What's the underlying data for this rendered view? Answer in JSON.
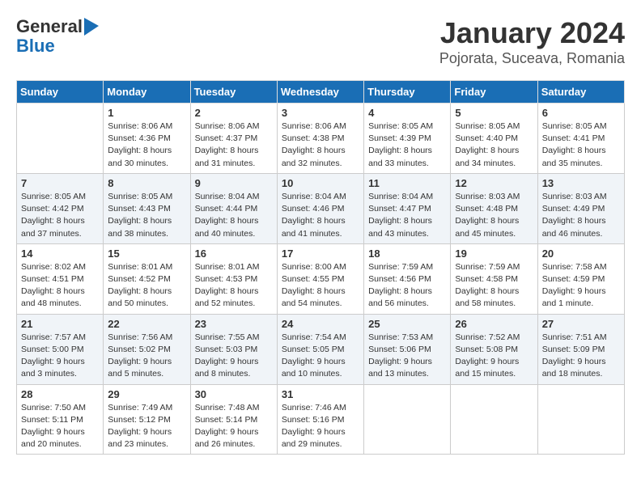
{
  "header": {
    "logo_line1": "General",
    "logo_line2": "Blue",
    "title": "January 2024",
    "subtitle": "Pojorata, Suceava, Romania"
  },
  "weekdays": [
    "Sunday",
    "Monday",
    "Tuesday",
    "Wednesday",
    "Thursday",
    "Friday",
    "Saturday"
  ],
  "weeks": [
    [
      {
        "num": "",
        "info": ""
      },
      {
        "num": "1",
        "info": "Sunrise: 8:06 AM\nSunset: 4:36 PM\nDaylight: 8 hours\nand 30 minutes."
      },
      {
        "num": "2",
        "info": "Sunrise: 8:06 AM\nSunset: 4:37 PM\nDaylight: 8 hours\nand 31 minutes."
      },
      {
        "num": "3",
        "info": "Sunrise: 8:06 AM\nSunset: 4:38 PM\nDaylight: 8 hours\nand 32 minutes."
      },
      {
        "num": "4",
        "info": "Sunrise: 8:05 AM\nSunset: 4:39 PM\nDaylight: 8 hours\nand 33 minutes."
      },
      {
        "num": "5",
        "info": "Sunrise: 8:05 AM\nSunset: 4:40 PM\nDaylight: 8 hours\nand 34 minutes."
      },
      {
        "num": "6",
        "info": "Sunrise: 8:05 AM\nSunset: 4:41 PM\nDaylight: 8 hours\nand 35 minutes."
      }
    ],
    [
      {
        "num": "7",
        "info": "Sunrise: 8:05 AM\nSunset: 4:42 PM\nDaylight: 8 hours\nand 37 minutes."
      },
      {
        "num": "8",
        "info": "Sunrise: 8:05 AM\nSunset: 4:43 PM\nDaylight: 8 hours\nand 38 minutes."
      },
      {
        "num": "9",
        "info": "Sunrise: 8:04 AM\nSunset: 4:44 PM\nDaylight: 8 hours\nand 40 minutes."
      },
      {
        "num": "10",
        "info": "Sunrise: 8:04 AM\nSunset: 4:46 PM\nDaylight: 8 hours\nand 41 minutes."
      },
      {
        "num": "11",
        "info": "Sunrise: 8:04 AM\nSunset: 4:47 PM\nDaylight: 8 hours\nand 43 minutes."
      },
      {
        "num": "12",
        "info": "Sunrise: 8:03 AM\nSunset: 4:48 PM\nDaylight: 8 hours\nand 45 minutes."
      },
      {
        "num": "13",
        "info": "Sunrise: 8:03 AM\nSunset: 4:49 PM\nDaylight: 8 hours\nand 46 minutes."
      }
    ],
    [
      {
        "num": "14",
        "info": "Sunrise: 8:02 AM\nSunset: 4:51 PM\nDaylight: 8 hours\nand 48 minutes."
      },
      {
        "num": "15",
        "info": "Sunrise: 8:01 AM\nSunset: 4:52 PM\nDaylight: 8 hours\nand 50 minutes."
      },
      {
        "num": "16",
        "info": "Sunrise: 8:01 AM\nSunset: 4:53 PM\nDaylight: 8 hours\nand 52 minutes."
      },
      {
        "num": "17",
        "info": "Sunrise: 8:00 AM\nSunset: 4:55 PM\nDaylight: 8 hours\nand 54 minutes."
      },
      {
        "num": "18",
        "info": "Sunrise: 7:59 AM\nSunset: 4:56 PM\nDaylight: 8 hours\nand 56 minutes."
      },
      {
        "num": "19",
        "info": "Sunrise: 7:59 AM\nSunset: 4:58 PM\nDaylight: 8 hours\nand 58 minutes."
      },
      {
        "num": "20",
        "info": "Sunrise: 7:58 AM\nSunset: 4:59 PM\nDaylight: 9 hours\nand 1 minute."
      }
    ],
    [
      {
        "num": "21",
        "info": "Sunrise: 7:57 AM\nSunset: 5:00 PM\nDaylight: 9 hours\nand 3 minutes."
      },
      {
        "num": "22",
        "info": "Sunrise: 7:56 AM\nSunset: 5:02 PM\nDaylight: 9 hours\nand 5 minutes."
      },
      {
        "num": "23",
        "info": "Sunrise: 7:55 AM\nSunset: 5:03 PM\nDaylight: 9 hours\nand 8 minutes."
      },
      {
        "num": "24",
        "info": "Sunrise: 7:54 AM\nSunset: 5:05 PM\nDaylight: 9 hours\nand 10 minutes."
      },
      {
        "num": "25",
        "info": "Sunrise: 7:53 AM\nSunset: 5:06 PM\nDaylight: 9 hours\nand 13 minutes."
      },
      {
        "num": "26",
        "info": "Sunrise: 7:52 AM\nSunset: 5:08 PM\nDaylight: 9 hours\nand 15 minutes."
      },
      {
        "num": "27",
        "info": "Sunrise: 7:51 AM\nSunset: 5:09 PM\nDaylight: 9 hours\nand 18 minutes."
      }
    ],
    [
      {
        "num": "28",
        "info": "Sunrise: 7:50 AM\nSunset: 5:11 PM\nDaylight: 9 hours\nand 20 minutes."
      },
      {
        "num": "29",
        "info": "Sunrise: 7:49 AM\nSunset: 5:12 PM\nDaylight: 9 hours\nand 23 minutes."
      },
      {
        "num": "30",
        "info": "Sunrise: 7:48 AM\nSunset: 5:14 PM\nDaylight: 9 hours\nand 26 minutes."
      },
      {
        "num": "31",
        "info": "Sunrise: 7:46 AM\nSunset: 5:16 PM\nDaylight: 9 hours\nand 29 minutes."
      },
      {
        "num": "",
        "info": ""
      },
      {
        "num": "",
        "info": ""
      },
      {
        "num": "",
        "info": ""
      }
    ]
  ]
}
